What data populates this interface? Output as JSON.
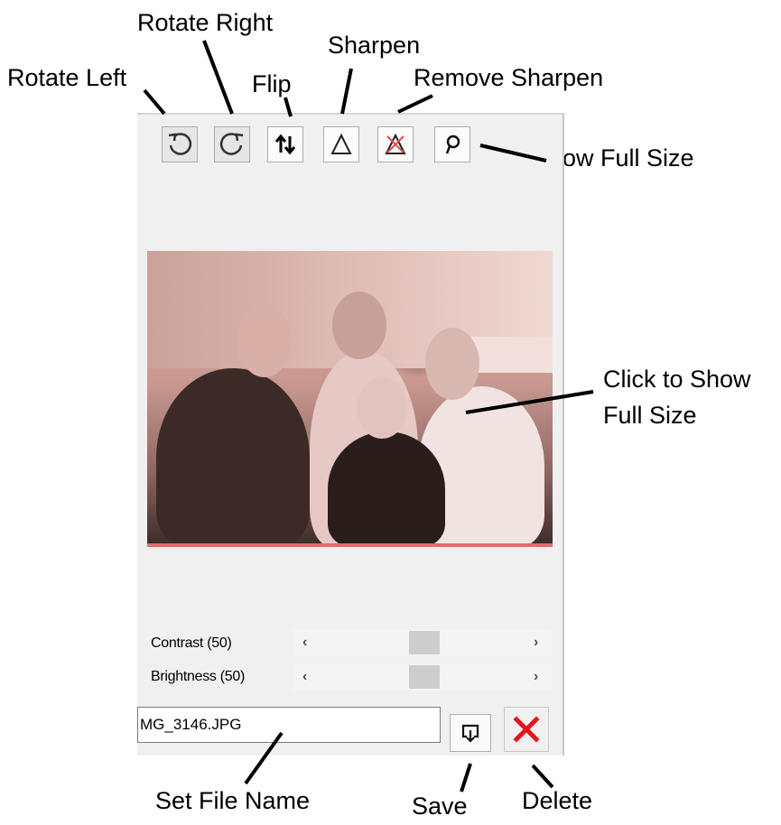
{
  "annotations": {
    "rotate_left": "Rotate Left",
    "rotate_right": "Rotate Right",
    "flip": "Flip",
    "sharpen": "Sharpen",
    "remove_sharpen": "Remove Sharpen",
    "show_full_size": "Show Full Size",
    "click_to_show_line1": "Click to Show",
    "click_to_show_line2": "Full Size",
    "set_file_name": "Set File Name",
    "save": "Save",
    "delete": "Delete"
  },
  "toolbar": {
    "icons": [
      "rotate-left-icon",
      "rotate-right-icon",
      "flip-icon",
      "sharpen-icon",
      "remove-sharpen-icon",
      "magnify-icon"
    ]
  },
  "sliders": {
    "contrast": {
      "label": "Contrast (50)",
      "left": "‹",
      "right": "›",
      "value": 50
    },
    "brightness": {
      "label": "Brightness (50)",
      "left": "‹",
      "right": "›",
      "value": 50
    }
  },
  "file": {
    "name": "MG_3146.JPG"
  },
  "colors": {
    "delete_red": "#e8141b",
    "panel_bg": "#f0f0f0"
  }
}
